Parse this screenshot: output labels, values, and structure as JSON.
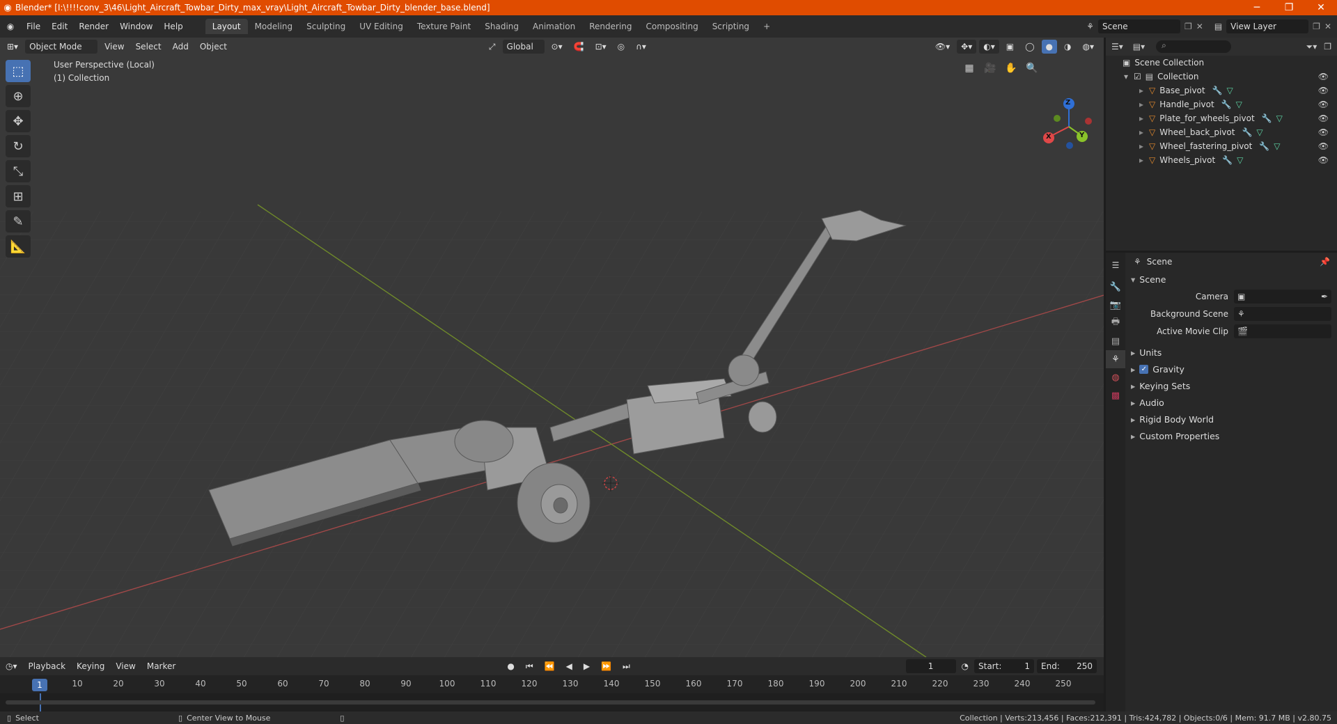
{
  "title": "Blender* [I:\\!!!!conv_3\\46\\Light_Aircraft_Towbar_Dirty_max_vray\\Light_Aircraft_Towbar_Dirty_blender_base.blend]",
  "menus": [
    "File",
    "Edit",
    "Render",
    "Window",
    "Help"
  ],
  "workspaces": [
    "Layout",
    "Modeling",
    "Sculpting",
    "UV Editing",
    "Texture Paint",
    "Shading",
    "Animation",
    "Rendering",
    "Compositing",
    "Scripting"
  ],
  "active_workspace": "Layout",
  "scene_name": "Scene",
  "view_layer": "View Layer",
  "viewport": {
    "mode": "Object Mode",
    "menus": [
      "View",
      "Select",
      "Add",
      "Object"
    ],
    "orientation": "Global",
    "perspective_label": "User Perspective (Local)",
    "collection_label": "(1) Collection",
    "axes": {
      "x": "X",
      "y": "Y",
      "z": "Z"
    }
  },
  "outliner": {
    "root": "Scene Collection",
    "collection": "Collection",
    "items": [
      "Base_pivot",
      "Handle_pivot",
      "Plate_for_wheels_pivot",
      "Wheel_back_pivot",
      "Wheel_fastering_pivot",
      "Wheels_pivot"
    ]
  },
  "properties": {
    "header": "Scene",
    "section": "Scene",
    "fields": [
      {
        "label": "Camera"
      },
      {
        "label": "Background Scene"
      },
      {
        "label": "Active Movie Clip"
      }
    ],
    "panels": [
      "Units",
      "Gravity",
      "Keying Sets",
      "Audio",
      "Rigid Body World",
      "Custom Properties"
    ]
  },
  "timeline": {
    "menus": [
      "Playback",
      "Keying",
      "View",
      "Marker"
    ],
    "current_frame": "1",
    "start_label": "Start:",
    "start": "1",
    "end_label": "End:",
    "end": "250",
    "ruler": [
      "10",
      "20",
      "30",
      "40",
      "50",
      "60",
      "70",
      "80",
      "90",
      "100",
      "110",
      "120",
      "130",
      "140",
      "150",
      "160",
      "170",
      "180",
      "190",
      "200",
      "210",
      "220",
      "230",
      "240",
      "250"
    ]
  },
  "status": {
    "left1": "Select",
    "left2": "Center View to Mouse",
    "right": "Collection | Verts:213,456 | Faces:212,391 | Tris:424,782 | Objects:0/6 | Mem: 91.7 MB | v2.80.75"
  }
}
